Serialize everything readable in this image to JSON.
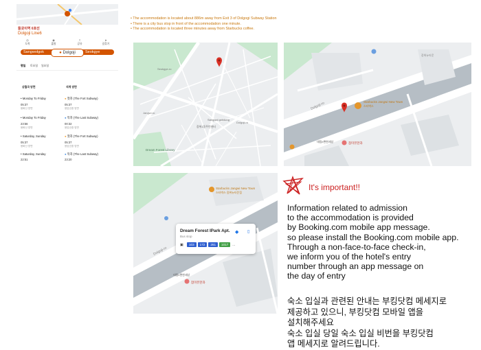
{
  "subway": {
    "title": "돌곶이역 6호선",
    "station_name": "Dolgoji Line6",
    "action_icons": [
      "도착",
      "출발",
      "공유",
      "길찾기"
    ],
    "route": {
      "prev": "Sangwolgok",
      "current": "Dolgoji",
      "next": "Seokgye"
    },
    "tabs": [
      "평일",
      "토요일",
      "일요일"
    ],
    "columns": [
      "상월곡 방면",
      "석계 방면"
    ],
    "schedule": [
      {
        "label": "Monday To Friday",
        "right": "The Fort Subway",
        "left_time": "05:37",
        "left_sub": "봉화산 방면",
        "right_time": "05:37",
        "right_sub": "응암순환 방면"
      },
      {
        "label": "Monday To Friday",
        "right": "The Last Subway",
        "left_time": "23:56",
        "left_sub": "봉화산 방면",
        "right_time": "00:32",
        "right_sub": "응암순환 방면"
      },
      {
        "label": "Saturday, Sunday",
        "right": "The Fort Subway",
        "left_time": "05:37",
        "left_sub": "봉화산 방면",
        "right_time": "05:37",
        "right_sub": "응암순환 방면"
      },
      {
        "label": "Saturday, Sunday",
        "right": "The Last Subway",
        "left_time": "22:51",
        "left_sub": "봉화산 방면",
        "right_time": "23:20",
        "right_sub": "응암순환 방면"
      }
    ]
  },
  "notes": [
    "The accommodation is located about 886m away from Exit 3 of Dolgogi Subway Station",
    "There is a city bus stop in front of the accommodation one minute.",
    "The accommodation is located three minutes away from Starbucks coffee."
  ],
  "maps": {
    "map1": {
      "labels": [
        "Seokgye-ro",
        "Dolgoji-ro",
        "Jangwi-ro",
        "Dream Forest Library",
        "Sangwol gokdong",
        "장위1동주민센터"
      ],
      "colors": {
        "water": "#a8dab5",
        "road": "#ffffff",
        "pin": "#d93025"
      }
    },
    "map2": {
      "labels": [
        "Dolgoji-ro",
        "Starbucks Jangwi New Town",
        "스타벅스",
        "대림e편한세상",
        "참미뷰한과",
        "장위뉴타운"
      ]
    },
    "map3": {
      "labels": [
        "Starbucks Jangwi New Town",
        "스타벅스 장위뉴타운점",
        "Dolgoji-ro",
        "대림e편한세상",
        "참미뷰한과"
      ],
      "bus_card": {
        "title": "Dream Forest IPark Apt.",
        "subtitle": "Bus stop",
        "routes": [
          {
            "num": "103",
            "color": "#2f5fd0"
          },
          {
            "num": "172",
            "color": "#2f5fd0"
          },
          {
            "num": "261",
            "color": "#2f5fd0"
          },
          {
            "num": "1017",
            "color": "#43a047"
          },
          {
            "num": "...",
            "color": "#ffffff"
          }
        ]
      }
    }
  },
  "important": {
    "title": "It's important!!",
    "mark_color": "#cc2222",
    "english_lines": [
      "Information related to admission",
      "to the accommodation is provided",
      "by Booking.com mobile app message.",
      "so please install the Booking.com mobile app.",
      "Through a non-face-to-face check-in,",
      "we inform you of the hotel's entry",
      "number through an app message on",
      "the day of entry"
    ],
    "korean_lines": [
      "숙소 입실과 관련된 안내는 부킹닷컴  메세지로",
      "제공하고 있으니, 부킹닷컴 모바일 앱을",
      "설치해주세요",
      "숙소 입실 당일 숙소 입실 비번을 부킹닷컴",
      "앱 메세지로 알려드립니다."
    ]
  }
}
